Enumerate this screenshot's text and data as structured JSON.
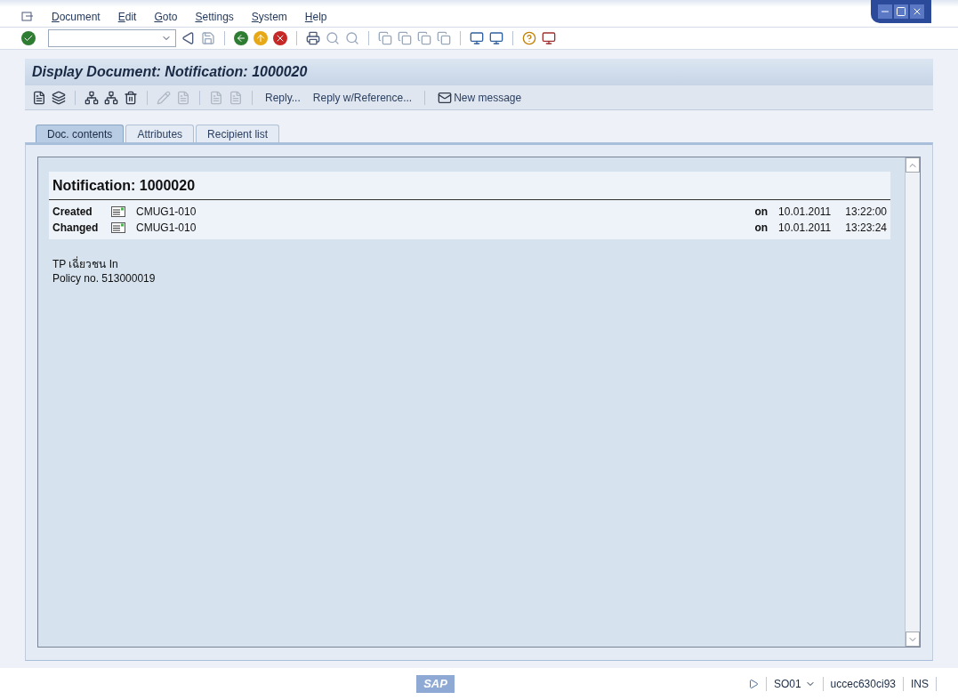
{
  "menu_bar": [
    "Document",
    "Edit",
    "Goto",
    "Settings",
    "System",
    "Help"
  ],
  "screen_title": "Display Document: Notification: 1000020",
  "app_toolbar": [
    {
      "label": "Reply..."
    },
    {
      "label": "Reply w/Reference..."
    },
    {
      "label": "New message"
    }
  ],
  "tabs": [
    {
      "label": "Doc. contents",
      "selected": true
    },
    {
      "label": "Attributes",
      "selected": false
    },
    {
      "label": "Recipient list",
      "selected": false
    }
  ],
  "document": {
    "heading": "Notification: 1000020",
    "entries": [
      {
        "label": "Created",
        "user": "CMUG1-010",
        "on": "on",
        "date": "10.01.2011",
        "time": "13:22:00"
      },
      {
        "label": "Changed",
        "user": "CMUG1-010",
        "on": "on",
        "date": "10.01.2011",
        "time": "13:23:24"
      }
    ],
    "body": [
      "TP เฉี่ยวชน In",
      "Policy no. 513000019"
    ]
  },
  "status_bar": {
    "logo": "SAP",
    "transaction": "SO01",
    "server": "uccec630ci93",
    "mode": "INS"
  }
}
